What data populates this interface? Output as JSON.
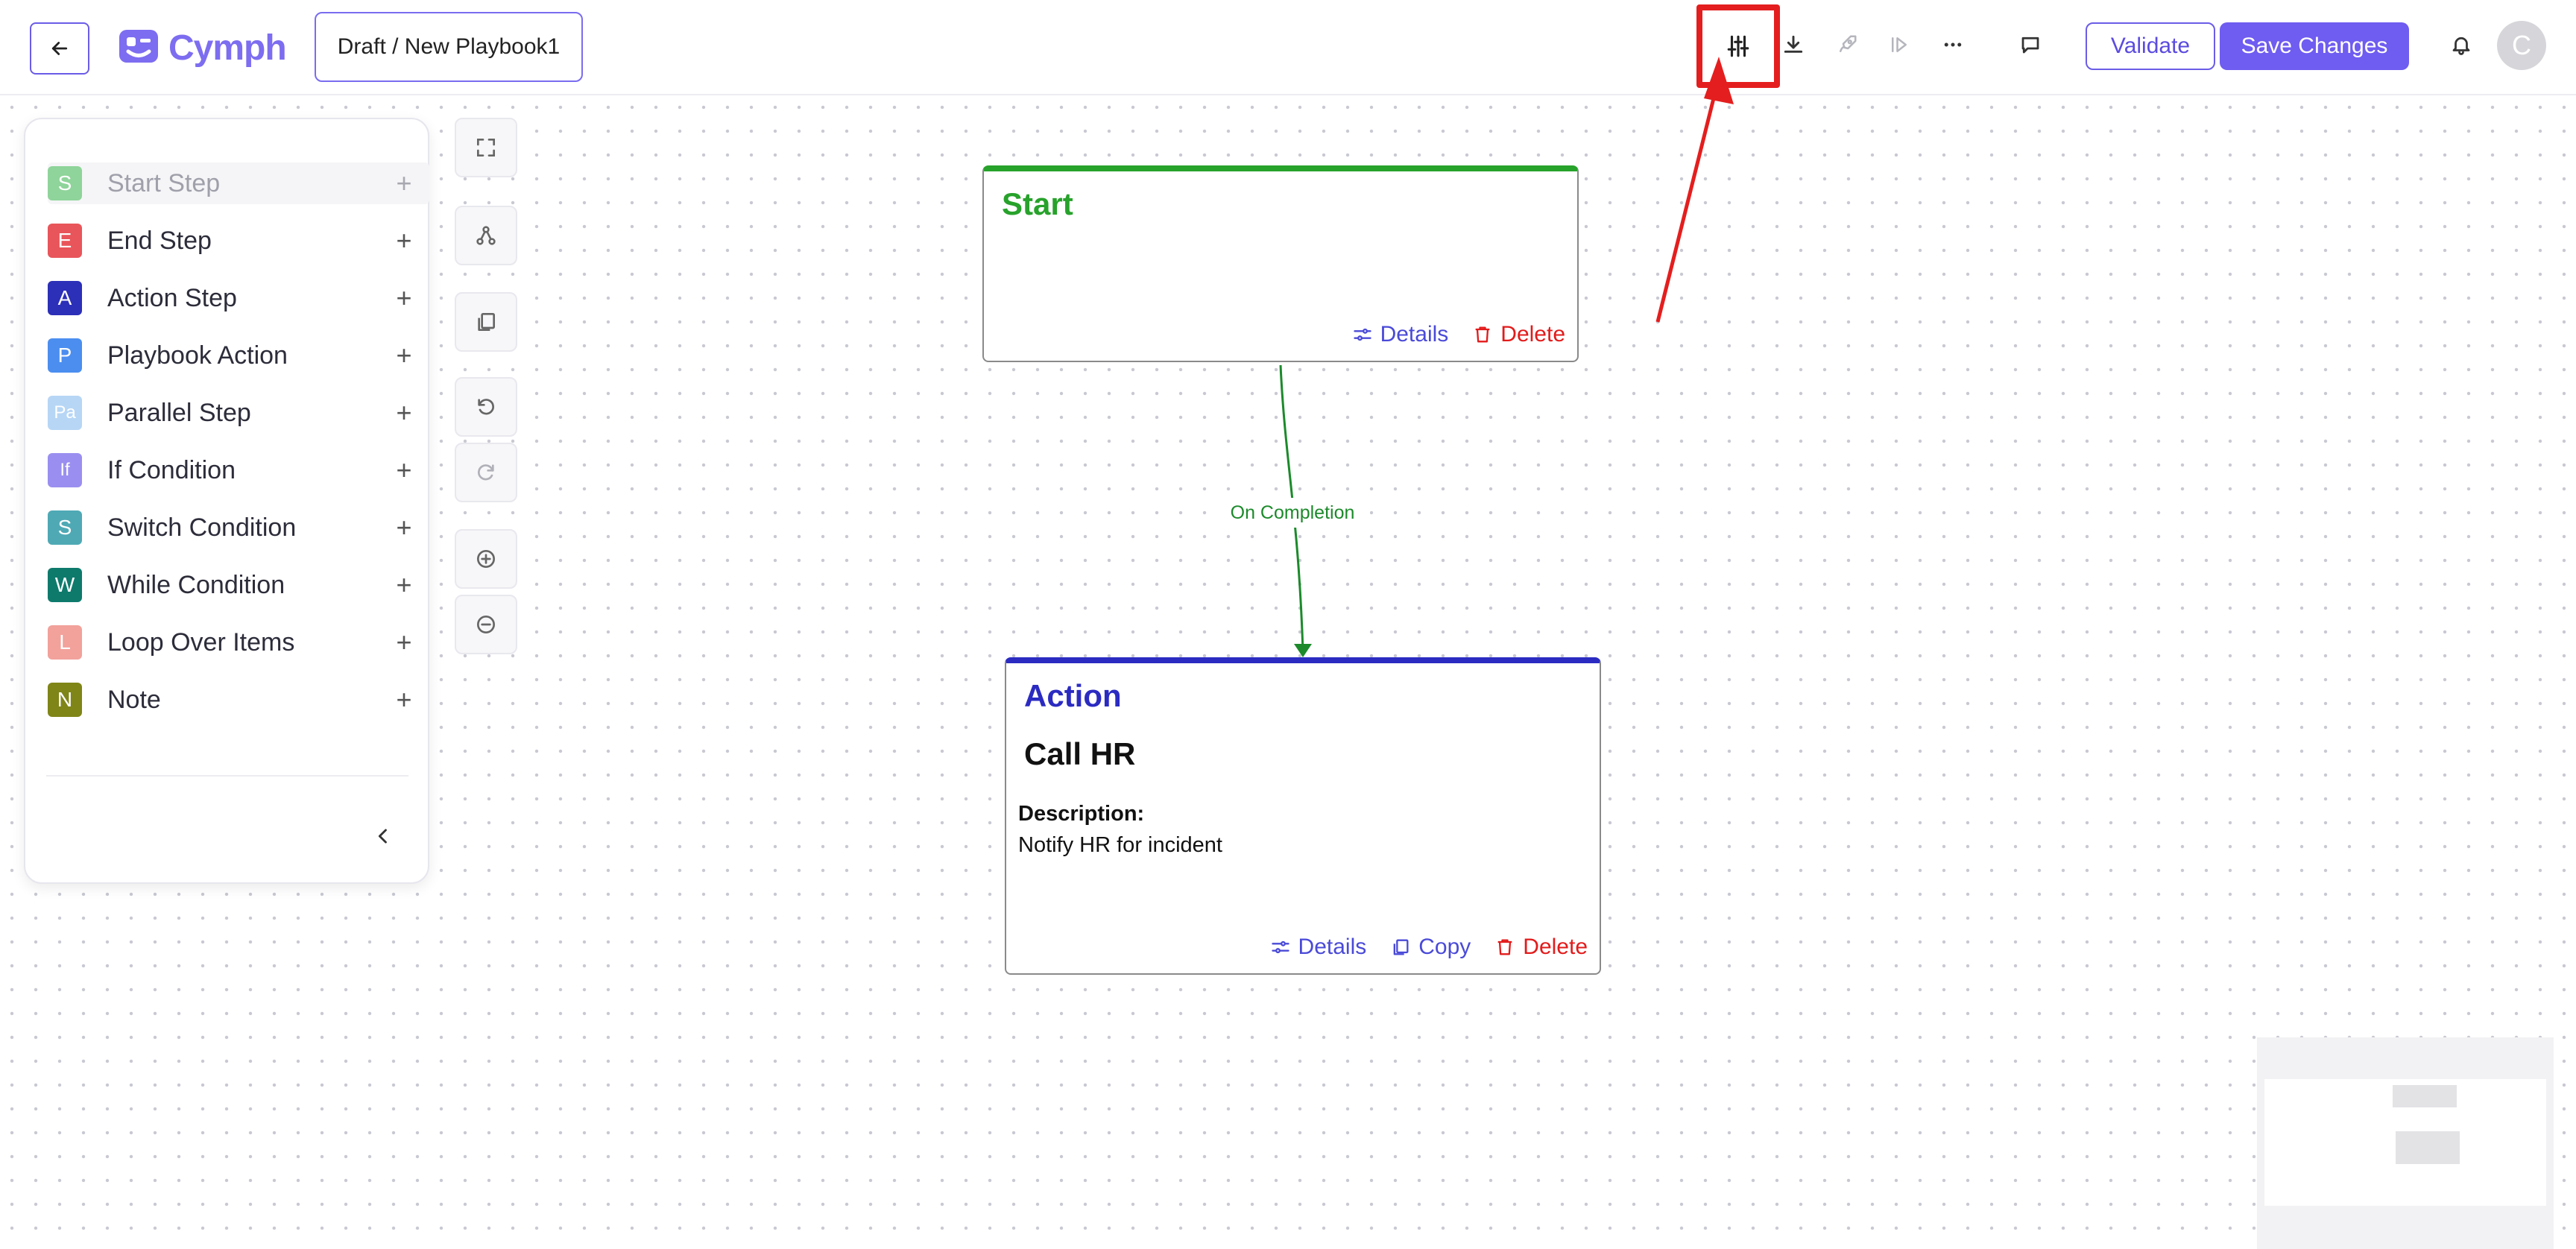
{
  "header": {
    "logo_text": "Cymph",
    "breadcrumb": "Draft / New Playbook1",
    "validate_label": "Validate",
    "save_label": "Save Changes",
    "avatar_initial": "C",
    "icons": [
      "back-arrow-icon",
      "sliders-icon",
      "download-icon",
      "rocket-icon",
      "run-icon",
      "more-icon",
      "comment-icon",
      "bell-icon"
    ],
    "highlight_color": "#e41e1e",
    "accent_color": "#6f5cf0"
  },
  "palette": {
    "items": [
      {
        "badge": "S",
        "label": "Start Step",
        "color": "#8fd49a",
        "disabled": true
      },
      {
        "badge": "E",
        "label": "End Step",
        "color": "#e8555a"
      },
      {
        "badge": "A",
        "label": "Action Step",
        "color": "#2c2fb8"
      },
      {
        "badge": "P",
        "label": "Playbook Action",
        "color": "#4b8ef0"
      },
      {
        "badge": "Pa",
        "label": "Parallel Step",
        "color": "#b7d6f5"
      },
      {
        "badge": "If",
        "label": "If Condition",
        "color": "#9a8ff0"
      },
      {
        "badge": "S",
        "label": "Switch Condition",
        "color": "#4fa9b5"
      },
      {
        "badge": "W",
        "label": "While Condition",
        "color": "#0e7a6c"
      },
      {
        "badge": "L",
        "label": "Loop Over Items",
        "color": "#f2a19b"
      },
      {
        "badge": "N",
        "label": "Note",
        "color": "#7f8517"
      }
    ],
    "plus_symbol": "+"
  },
  "canvas": {
    "start_node": {
      "type": "Start",
      "details_label": "Details",
      "delete_label": "Delete"
    },
    "edge_label": "On Completion",
    "action_node": {
      "type": "Action",
      "title": "Call HR",
      "description_label": "Description:",
      "description": "Notify HR for incident",
      "details_label": "Details",
      "copy_label": "Copy",
      "delete_label": "Delete"
    }
  }
}
